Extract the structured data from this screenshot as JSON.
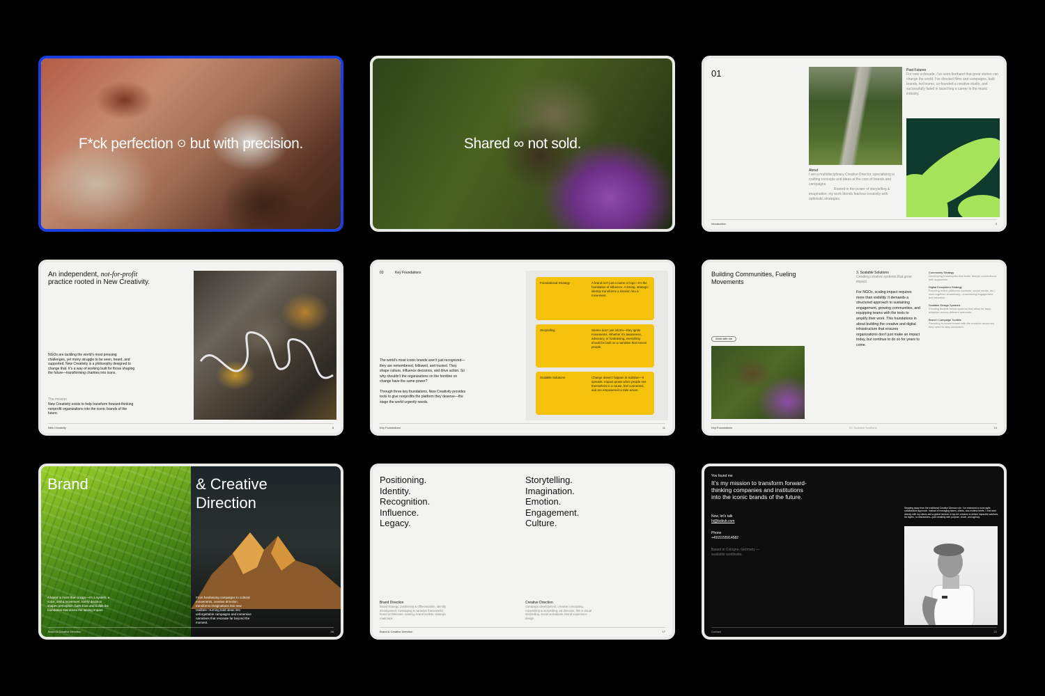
{
  "slides": [
    {
      "id": 1,
      "selected": true,
      "headline_before": "F*ck perfection",
      "headline_symbol": "⊙",
      "headline_after": "but with precision."
    },
    {
      "id": 2,
      "headline_before": "Shared",
      "headline_symbol": "∞",
      "headline_after": "not sold."
    },
    {
      "id": 3,
      "number": "01",
      "past_futures_title": "Past Futures",
      "past_futures_body": "For over a decade, I’ve seen firsthand that great stories can change the world. I’ve directed films and campaigns, built brands, led teams, co-founded a creative studio, and successfully failed in launching a career in the music industry.",
      "about_title": "About",
      "about_body": "I am a multidisciplinary Creative Director, specializing in crafting concepts and ideas at the core of brands and campaigns.",
      "about_body_2": "Rooted in the power of storytelling & imagination, my work blends fearless creativity with optimistic strategies.",
      "footer_left": "Introduction",
      "footer_right": "3"
    },
    {
      "id": 4,
      "title_start": "An independent,",
      "title_italic": "not-for-profit",
      "title_end": "practice rooted in New Creativity.",
      "body": "NGOs are tackling the world’s most pressing challenges, yet many struggle to be seen, heard, and supported. New Creativity is a philosophy designed to change that. It’s a way of working built for those shaping the future—transforming charities into icons.",
      "mission_label": "The mission",
      "mission_body": "New Creativity exists to help transform forward-thinking nonprofit organizations into the iconic brands of the future.",
      "footer_left": "New Creativity",
      "footer_right": "8"
    },
    {
      "id": 5,
      "number": "03",
      "title": "Key Foundations",
      "body_1": "The world’s most iconic brands aren’t just recognized—they are remembered, followed, and trusted. They shape culture, influence decisions, and drive action. So why shouldn’t the organizations on the frontline on change have the same power?",
      "body_2": "Through three key foundations, New Creativity provides tools to give nonprofits the platform they deserve—the stage the world urgently needs.",
      "cards": [
        {
          "label": "Foundational Strategy",
          "text": "A brand isn’t just a name or logo—it’s the foundation of influence. A strong, strategic identity transforms a mission into a movement."
        },
        {
          "label": "Storytelling",
          "text": "Stories don’t just inform—they ignite movements. Whether it’s awareness, advocacy, or fundraising, everything should be built on a narrative that moves people."
        },
        {
          "label": "Scalable Solutions",
          "text": "Change doesn’t happen in isolation—it spreads. Impact grows when people see themselves in a cause, feel connected, and are empowered to take action."
        }
      ],
      "footer_left": "Key Foundations",
      "footer_right": "11"
    },
    {
      "id": 6,
      "title": "Building Communities, Fueling Movements",
      "button": "Work with me",
      "section": "3.  Scalable Solutions",
      "section_sub": "Creating creative systems that grow impact.",
      "body": "For NGOs, scaling impact requires more than visibility. It demands a structured approach to sustaining engagement, growing communities, and equipping teams with the tools to amplify their work. This foundations in about building the creative and digital infrastructure that ensures organizations don’t just make an impact today, but continue to do so for years to come.",
      "items": [
        {
          "title": "Community Strategy",
          "text": "Developing frameworks that foster deeper connections with supporters."
        },
        {
          "title": "Digital Ecosystem Strategy",
          "text": "Ensuring online platforms (website, social media, etc.) work together seamlessly—maximizing engagement and retention."
        },
        {
          "title": "Scalable Design Systems",
          "text": "Creating flexible brand systems that allow for easy adaption across different materials."
        },
        {
          "title": "Brand / Campaign Toolkits",
          "text": "Providing in-house teams with the creative resources they need to stay consistent."
        }
      ],
      "footer_left": "Key Foundations",
      "footer_mid": "03. Scalable Solutions",
      "footer_right": "14"
    },
    {
      "id": 7,
      "word_left": "Brand",
      "word_right": "& Creative Direction",
      "left_body": "A brand is more than a logo—it’s a system, a voice, and a movement. Every decision shapes perception, fuels trust and builds the foundation that drives the lasting impact.",
      "right_body": "From fundraising campaigns to cultural movements, creative direction transforms imaginations into new realities—turning bold ideas into unforgettable campaigns and immersive narratives that resonate far beyond the moment.",
      "footer_left": "Brand & Creative Direction",
      "footer_right": "16"
    },
    {
      "id": 8,
      "list_left": [
        "Positioning.",
        "Identity.",
        "Recognition.",
        "Influence.",
        "Legacy."
      ],
      "list_right": [
        "Storytelling.",
        "Imagination.",
        "Emotion.",
        "Engagement.",
        "Culture."
      ],
      "col_left_title": "Brand Direction",
      "col_left_body": "Brand strategy, positioning & differentiation, identity development, messaging & narrative frameworks, brand architecture, naming, brand toolkits, strategic roadmaps.",
      "col_right_title": "Creative Direction",
      "col_right_body": "Campaign development, creative concepting, copywriting & storytelling, art direction, film & visual storytelling, social activations, brand experience design.",
      "footer_left": "Brand & Creative Direction",
      "footer_right": "17"
    },
    {
      "id": 9,
      "eyebrow": "You found me",
      "headline": "It’s my mission to transform forward-thinking companies and institutions into the iconic brands of the future.",
      "talk_label": "Now, let’s talk",
      "email": "hi@bobvb.com",
      "phone_label": "Phone",
      "phone": "+4915155914582",
      "location": "Based in Cologne, Germany —available worldwide.",
      "side_text": "Stepping away from the traditional Creative Director role, I’ve embraced a more agile, collaborative approach. Instead of managing teams, clients, and endless briefs, I now work directly with my clients and a global network of top-tier creators to deliver impactful solutions. No layers, no distractions—just creativity with purpose, vision, and agency.",
      "footer_left": "Contact",
      "footer_right": "22"
    }
  ],
  "colors": {
    "background": "#000000",
    "slide_paper": "#f3f3f1",
    "selection": "#1a3fe0",
    "yellow_card": "#f4c20d",
    "lime": "#a6e35a",
    "forest": "#0f3a2e"
  }
}
